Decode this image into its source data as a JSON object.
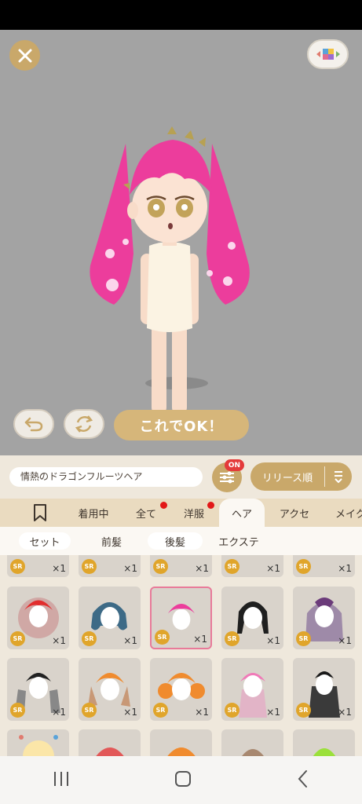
{
  "stage": {
    "ok_label": "これでOK！"
  },
  "toolbar": {
    "item_name": "情熱のドラゴンフルーツヘア",
    "filter_badge": "ON",
    "sort_label": "リリース順"
  },
  "tabs": [
    {
      "label": "着用中",
      "dot": false
    },
    {
      "label": "全て",
      "dot": true
    },
    {
      "label": "洋服",
      "dot": true
    },
    {
      "label": "ヘア",
      "dot": false
    },
    {
      "label": "アクセ",
      "dot": false
    },
    {
      "label": "メイク",
      "dot": false
    }
  ],
  "subtabs": [
    {
      "label": "セット"
    },
    {
      "label": "前髪"
    },
    {
      "label": "後髪"
    },
    {
      "label": "エクステ"
    }
  ],
  "items": {
    "rarity": "SR",
    "quantity": "×1"
  },
  "colors": {
    "gold": "#c9a86a",
    "stage_bg": "#a3a3a3",
    "selected_border": "#e87a99",
    "hair_pink": "#ec3d9c"
  }
}
